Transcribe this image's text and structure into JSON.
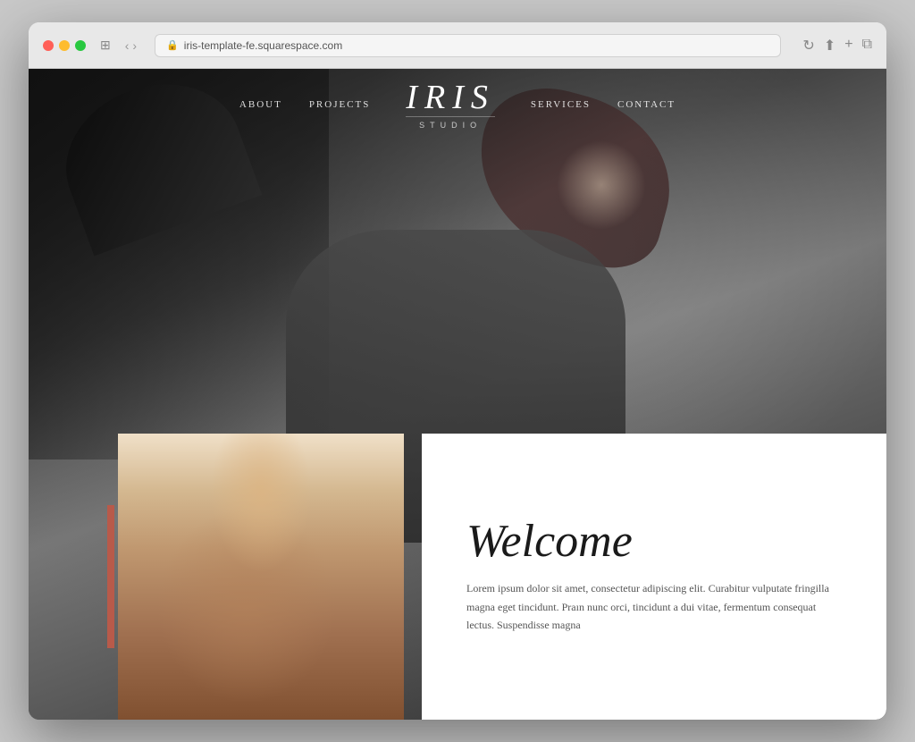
{
  "browser": {
    "url": "iris-template-fe.squarespace.com",
    "traffic_lights": [
      "red",
      "yellow",
      "green"
    ]
  },
  "nav": {
    "links_left": [
      "ABOUT",
      "PROJECTS"
    ],
    "links_right": [
      "SERVICES",
      "CONTACT"
    ],
    "logo_main": "IRIS",
    "logo_sub": "STUDIO"
  },
  "hero": {
    "alt_text": "Black and white fashion photo of woman in sweater"
  },
  "welcome": {
    "title": "Welcome",
    "body": "Lorem ipsum dolor sit amet, consectetur adipiscing elit. Curabitur vulputate fringilla magna eget tincidunt. Praın nunc orci, tincidunt a dui vitae, fermentum consequat lectus. Suspendisse magna"
  }
}
